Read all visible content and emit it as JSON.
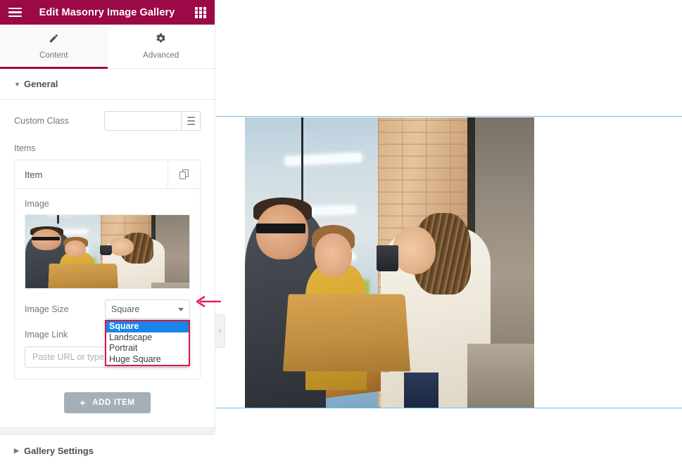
{
  "panel": {
    "header": {
      "title": "Edit Masonry Image Gallery",
      "menu_icon": "hamburger-icon",
      "grid_icon": "grid-apps-icon"
    },
    "tabs": [
      {
        "label": "Content",
        "icon": "pencil-icon",
        "active": true
      },
      {
        "label": "Advanced",
        "icon": "gear-icon",
        "active": false
      }
    ],
    "sections": [
      {
        "label": "General",
        "expanded": true
      },
      {
        "label": "Gallery Settings",
        "expanded": false
      }
    ],
    "controls": {
      "custom_class": {
        "label": "Custom Class",
        "value": "",
        "placeholder": "",
        "dynamic_icon": "database-stack-icon"
      },
      "items": {
        "label": "Items",
        "row_title": "Item",
        "duplicate_icon": "duplicate-icon"
      },
      "image": {
        "label": "Image"
      },
      "image_size": {
        "label": "Image Size",
        "value": "Square",
        "options": [
          "Square",
          "Landscape",
          "Portrait",
          "Huge Square"
        ],
        "selected_index": 0,
        "caret_icon": "chevron-down-icon"
      },
      "image_link": {
        "label": "Image Link",
        "value": "",
        "placeholder": "Paste URL or type"
      },
      "add_item": {
        "label": "ADD ITEM",
        "plus_icon": "plus-icon"
      }
    },
    "collapse_handle": {
      "icon": "chevron-left-icon",
      "glyph": "‹"
    }
  },
  "canvas": {
    "preview_alt": "masonry gallery image of three coworkers at a laptop in a loft office",
    "guides": {
      "top": "section-guide-line",
      "bottom": "section-guide-line"
    }
  },
  "annotation": {
    "arrow": "pink-left-arrow"
  },
  "colors": {
    "header_bg": "#9b0a46",
    "tab_underline": "#9b0a46",
    "option_highlight": "#1a84e8",
    "dropdown_outline": "#d81b45",
    "guide_line": "#6ec1e4",
    "arrow": "#e91e63",
    "add_item_bg": "#a4afb7"
  }
}
